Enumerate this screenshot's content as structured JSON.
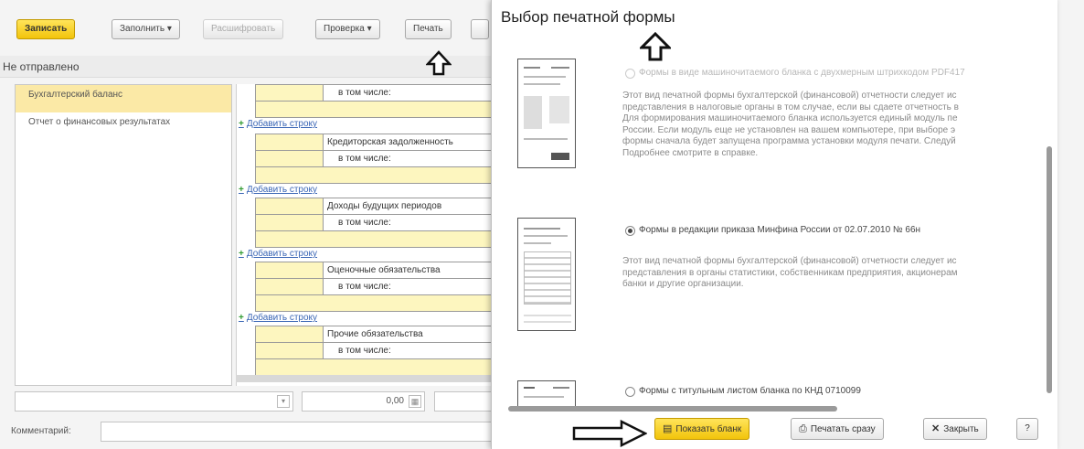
{
  "toolbar": {
    "save": "Записать",
    "fill": "Заполнить",
    "decrypt": "Расшифровать",
    "check": "Проверка",
    "print": "Печать"
  },
  "status": "Не отправлено",
  "sections": [
    "Бухгалтерский баланс",
    "Отчет о финансовых результатах"
  ],
  "report": {
    "in_that_number": "в том числе:",
    "add_row": "Добавить строку",
    "rows": [
      "Кредиторская задолженность",
      "Доходы будущих периодов",
      "Оценочные обязательства",
      "Прочие обязательства"
    ]
  },
  "bottom": {
    "amount": "0,00",
    "comment_label": "Комментарий:"
  },
  "dialog": {
    "title": "Выбор печатной формы",
    "options": [
      {
        "label": "Формы в виде машиночитаемого бланка с двухмерным штрихкодом PDF417",
        "selected": false,
        "disabled": true,
        "description": "Этот вид печатной формы бухгалтерской (финансовой) отчетности следует ис\nпредставления в налоговые органы в том случае, если вы сдаете отчетность в\nДля формирования машиночитаемого бланка используется единый модуль пе\nРоссии. Если модуль еще не установлен на вашем компьютере, при выборе э\nформы сначала будет запущена программа установки модуля печати. Следуй\nПодробнее смотрите в справке."
      },
      {
        "label": "Формы в редакции приказа Минфина России от 02.07.2010 № 66н",
        "selected": true,
        "disabled": false,
        "description": "Этот вид печатной формы бухгалтерской (финансовой) отчетности следует ис\nпредставления в органы статистики, собственникам предприятия, акционерам\nбанки и другие организации."
      },
      {
        "label": "Формы с титульным листом бланка по КНД 0710099",
        "selected": false,
        "disabled": false,
        "description": ""
      }
    ],
    "buttons": {
      "show": "Показать бланк",
      "print_now": "Печатать сразу",
      "close": "Закрыть",
      "help": "?"
    }
  },
  "icons": [
    "up-arrow-icon",
    "right-arrow-icon",
    "dropdown-arrow-icon",
    "calculator-icon",
    "show-form-icon",
    "printer-icon",
    "close-icon",
    "radio-icon"
  ],
  "colors": {
    "accent_yellow": "#f2c40b",
    "selection": "#fbe9a6",
    "input_yellow": "#fdf6bf",
    "link_blue": "#3a66b5",
    "plus_green": "#2f9a2f"
  }
}
